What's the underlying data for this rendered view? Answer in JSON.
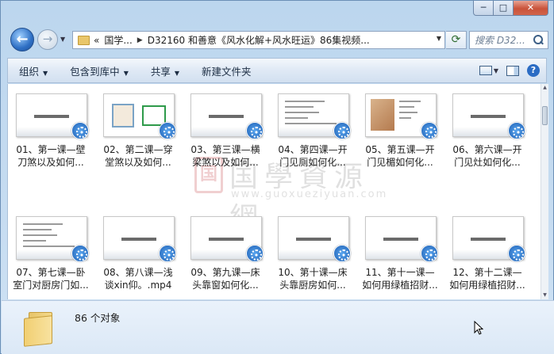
{
  "window": {
    "min_glyph": "─",
    "max_glyph": "□",
    "close_glyph": "✕"
  },
  "nav": {
    "back_glyph": "←",
    "forward_glyph": "→",
    "address": {
      "overflow": "«",
      "segments": [
        "国学...",
        "D32160 和善意《风水化解+风水旺运》86集视频..."
      ]
    },
    "search_placeholder": "搜索 D32..."
  },
  "toolbar": {
    "items": [
      {
        "label": "组织",
        "dropdown": true
      },
      {
        "label": "包含到库中",
        "dropdown": true
      },
      {
        "label": "共享",
        "dropdown": true
      },
      {
        "label": "新建文件夹",
        "dropdown": false
      }
    ],
    "help_glyph": "?"
  },
  "files": [
    {
      "line1": "01、第一课—壁",
      "line2": "刀煞以及如何...",
      "thumb": "title"
    },
    {
      "line1": "02、第二课—穿",
      "line2": "堂煞以及如何...",
      "thumb": "plan"
    },
    {
      "line1": "03、第三课—横",
      "line2": "梁煞以及如何...",
      "thumb": "title"
    },
    {
      "line1": "04、第四课—开",
      "line2": "门见厕如何化...",
      "thumb": "text"
    },
    {
      "line1": "05、第五课—开",
      "line2": "门见楣如何化...",
      "thumb": "room"
    },
    {
      "line1": "06、第六课—开",
      "line2": "门见灶如何化...",
      "thumb": "title"
    },
    {
      "line1": "07、第七课—卧",
      "line2": "室门对厨房门如...",
      "thumb": "text"
    },
    {
      "line1": "08、第八课—浅",
      "line2": "谈xin仰。.mp4",
      "thumb": "title"
    },
    {
      "line1": "09、第九课—床",
      "line2": "头靠窗如何化...",
      "thumb": "title"
    },
    {
      "line1": "10、第十课—床",
      "line2": "头靠厨房如何...",
      "thumb": "title"
    },
    {
      "line1": "11、第十一课—",
      "line2": "如何用绿植招财...",
      "thumb": "title"
    },
    {
      "line1": "12、第十二课—",
      "line2": "如何用绿植招财...",
      "thumb": "title"
    }
  ],
  "watermark": {
    "seal": "国",
    "title": "国學資源網",
    "url": "www.guoxueziyuan.com"
  },
  "details": {
    "count_text": "86 个对象"
  }
}
